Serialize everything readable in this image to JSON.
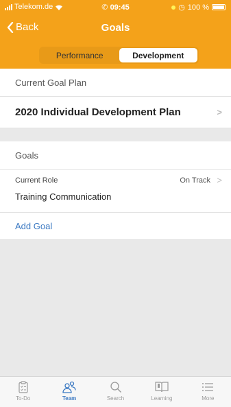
{
  "status_bar": {
    "carrier": "Telekom.de",
    "time": "09:45",
    "battery": "100 %"
  },
  "nav": {
    "back_label": "Back",
    "title": "Goals"
  },
  "segments": {
    "performance": "Performance",
    "development": "Development",
    "selected": "Development"
  },
  "plan_section": {
    "header": "Current Goal Plan",
    "plan_name": "2020 Individual Development Plan"
  },
  "goals_section": {
    "header": "Goals",
    "goal": {
      "category": "Current Role",
      "status": "On Track",
      "name": "Training Communication"
    },
    "add_goal": "Add Goal"
  },
  "tabs": {
    "todo": "To-Do",
    "team": "Team",
    "search": "Search",
    "learning": "Learning",
    "more": "More",
    "selected": "Team"
  },
  "colors": {
    "accent": "#f4a21a",
    "link": "#3a78c2"
  }
}
